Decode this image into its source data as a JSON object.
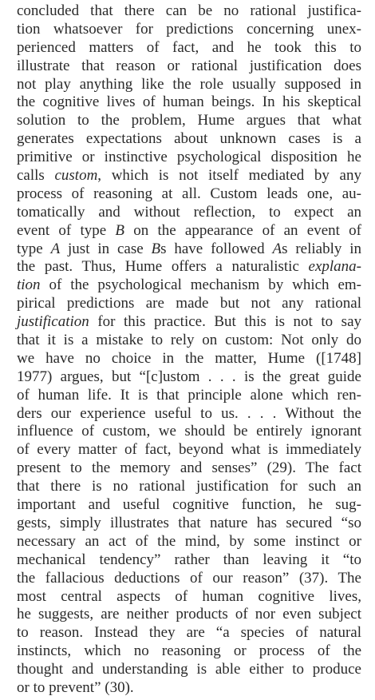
{
  "document": {
    "lines": [
      [
        {
          "t": "concluded that there can be no rational justifica-"
        }
      ],
      [
        {
          "t": "tion whatsoever for predictions concerning unex-"
        }
      ],
      [
        {
          "t": "perienced matters of fact, and he took this to"
        }
      ],
      [
        {
          "t": "illustrate that reason or rational justification does"
        }
      ],
      [
        {
          "t": "not play anything like the role usually supposed in"
        }
      ],
      [
        {
          "t": "the cognitive lives of human beings. In his skeptical"
        }
      ],
      [
        {
          "t": "solution to the problem, Hume argues that what"
        }
      ],
      [
        {
          "t": "generates expectations about unknown cases is a"
        }
      ],
      [
        {
          "t": "primitive or instinctive psychological disposition he"
        }
      ],
      [
        {
          "t": "calls "
        },
        {
          "t": "custom",
          "i": true
        },
        {
          "t": ", which is not itself mediated by any"
        }
      ],
      [
        {
          "t": "process of reasoning at all. Custom leads one, au-"
        }
      ],
      [
        {
          "t": "tomatically and without reflection, to expect an"
        }
      ],
      [
        {
          "t": "event of type "
        },
        {
          "t": "B",
          "i": true
        },
        {
          "t": " on the appearance of an event of"
        }
      ],
      [
        {
          "t": "type "
        },
        {
          "t": "A",
          "i": true
        },
        {
          "t": " just in case "
        },
        {
          "t": "B",
          "i": true
        },
        {
          "t": "s have followed "
        },
        {
          "t": "A",
          "i": true
        },
        {
          "t": "s reliably in"
        }
      ],
      [
        {
          "t": "the past. Thus, Hume offers a naturalistic "
        },
        {
          "t": "explana-",
          "i": true
        }
      ],
      [
        {
          "t": "tion",
          "i": true
        },
        {
          "t": " of the psychological mechanism by which em-"
        }
      ],
      [
        {
          "t": "pirical predictions are made but not any rational"
        }
      ],
      [
        {
          "t": "justification",
          "i": true
        },
        {
          "t": " for this practice. But this is not to say"
        }
      ],
      [
        {
          "t": "that it is a mistake to rely on custom: Not only do"
        }
      ],
      [
        {
          "t": "we have no choice in the matter, Hume ([1748]"
        }
      ],
      [
        {
          "t": "1977) argues, but “[c]ustom . . . is the great guide"
        }
      ],
      [
        {
          "t": "of human life. It is that principle alone which ren-"
        }
      ],
      [
        {
          "t": "ders our experience useful to us. . . . Without the"
        }
      ],
      [
        {
          "t": "influence of custom, we should be entirely ignorant"
        }
      ],
      [
        {
          "t": "of every matter of fact, beyond what is immediately"
        }
      ],
      [
        {
          "t": "present to the memory and senses” (29). The fact"
        }
      ],
      [
        {
          "t": "that there is no rational justification for such an"
        }
      ],
      [
        {
          "t": "important and useful cognitive function, he sug-"
        }
      ],
      [
        {
          "t": "gests, simply illustrates that nature has secured “so"
        }
      ],
      [
        {
          "t": "necessary an act of the mind, by some instinct or"
        }
      ],
      [
        {
          "t": "mechanical tendency” rather than leaving it “to"
        }
      ],
      [
        {
          "t": "the fallacious deductions of our reason” (37). The"
        }
      ],
      [
        {
          "t": "most central aspects of human cognitive lives,"
        }
      ],
      [
        {
          "t": "he suggests, are neither products of nor even subject"
        }
      ],
      [
        {
          "t": "to reason. Instead they are “a species of natural"
        }
      ],
      [
        {
          "t": "instincts, which no reasoning or process of the"
        }
      ],
      [
        {
          "t": "thought and understanding is able either to produce"
        }
      ],
      [
        {
          "t": "or to prevent” (30)."
        }
      ]
    ]
  }
}
